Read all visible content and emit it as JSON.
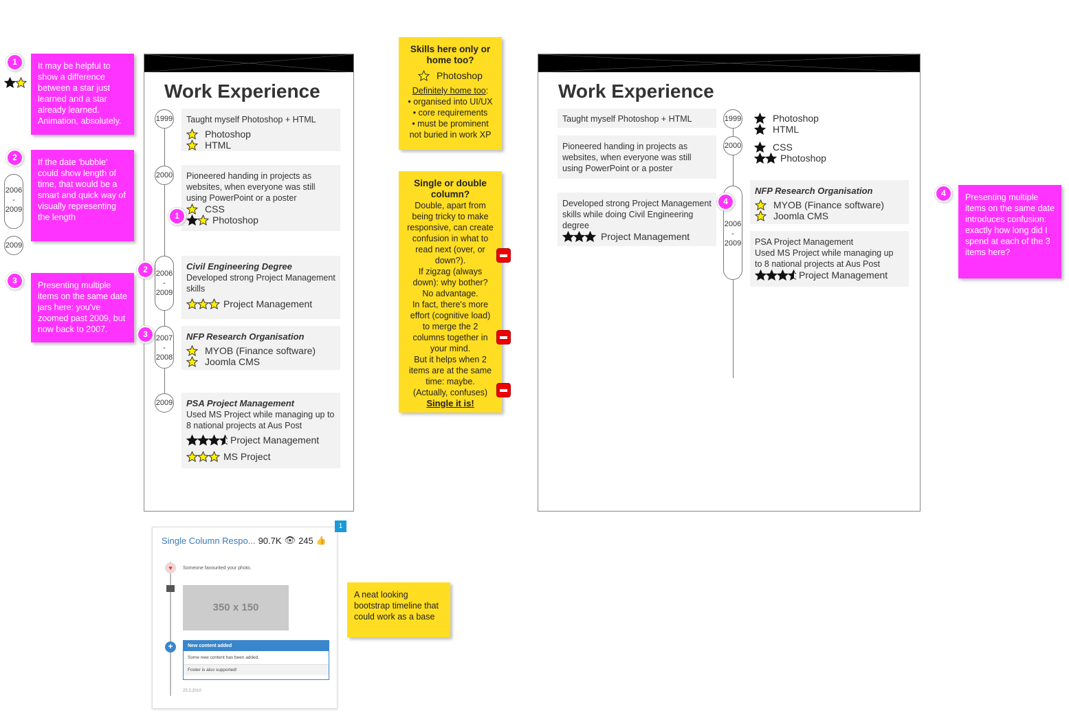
{
  "colors": {
    "pink": "#ff33ff",
    "yellow": "#ffdd22",
    "star_fill": "#ffee00",
    "star_dark": "#111111",
    "entry_bg": "#f2f2f2"
  },
  "left_notes": {
    "n1": {
      "num": "1",
      "text": "It may be helpful to show a difference between a star just learned and a star already learned. Animation, absolutely."
    },
    "n2": {
      "num": "2",
      "text": "If the date 'bubble' could show length of time, that would be a smart and quick way of visually representing the length",
      "pill_top": "2006",
      "pill_mid": "-",
      "pill_bot": "2009",
      "round": "2009"
    },
    "n3": {
      "num": "3",
      "text": "Presenting multiple items on the same date jars here: you've zoomed past 2009, but now back to 2007."
    },
    "n4": {
      "num": "4",
      "text": "Presenting multiple items on the same date introduces confusion: exactly how long did I spend at each of the 3 items here?"
    }
  },
  "yellow_notes": {
    "skills": {
      "title": "Skills here only or home too?",
      "skill": "Photoshop",
      "link": "Definitely home too",
      "colon": ":",
      "lines": [
        "• organised into UI/UX",
        "• core requirements",
        "• must be prominent",
        "not buried in work XP"
      ]
    },
    "column": {
      "title": "Single or double column?",
      "lines": [
        "Double, apart from",
        "being tricky to make",
        "responsive, can create",
        "confusion in what to",
        "read next (over, or",
        "down?).",
        "If zigzag (always",
        "down): why bother?",
        "No advantage.",
        "In fact, there's more",
        "effort (cognitive load)",
        "to merge the 2",
        "columns together in",
        "your mind.",
        "But it helps when 2",
        "items are at the same",
        "time: maybe.",
        "(Actually, confuses)"
      ],
      "conclusion": "Single it is!"
    },
    "bootstrap": {
      "text": "A neat looking bootstrap timeline that could work as a base"
    }
  },
  "single_column": {
    "title": "Work Experience",
    "entries": [
      {
        "date": "1999",
        "desc": "Taught myself Photoshop + HTML",
        "skills": [
          {
            "name": "Photoshop",
            "stars": "y"
          },
          {
            "name": "HTML",
            "stars": "y"
          }
        ]
      },
      {
        "date": "2000",
        "desc": "Pioneered handing in projects as websites, when everyone was still using PowerPoint or a poster",
        "skills": [
          {
            "name": "CSS",
            "stars": "y"
          },
          {
            "name": "Photoshop",
            "stars": "dy"
          }
        ]
      },
      {
        "date_top": "2006",
        "date_mid": "-",
        "date_bot": "2009",
        "org": "Civil Engineering Degree",
        "desc": "Developed strong Project Management skills",
        "skills": [
          {
            "name": "Project Management",
            "stars": "yyy"
          }
        ]
      },
      {
        "date_top": "2007",
        "date_mid": "-",
        "date_bot": "2008",
        "org": "NFP Research Organisation",
        "skills": [
          {
            "name": "MYOB (Finance software)",
            "stars": "y"
          },
          {
            "name": "Joomla CMS",
            "stars": "y"
          }
        ]
      },
      {
        "date": "2009",
        "org": "PSA Project Management",
        "desc": "Used MS Project while managing up to 8 national projects at Aus Post",
        "skills": [
          {
            "name": "Project Management",
            "stars": "dddh"
          },
          {
            "name": "MS Project",
            "stars": "yyy"
          }
        ]
      }
    ]
  },
  "double_column": {
    "title": "Work Experience",
    "left": [
      {
        "desc": "Taught myself Photoshop + HTML"
      },
      {
        "desc": "Pioneered handing in projects as websites, when everyone was still using PowerPoint or a poster"
      },
      {
        "desc": "Developed strong Project Management skills while doing Civil Engineering degree",
        "skill": "Project Management"
      }
    ],
    "dates": {
      "d1": "1999",
      "d2": "2000",
      "pill_top": "2006",
      "pill_mid": "-",
      "pill_bot": "2009"
    },
    "right_skills_1999": [
      "Photoshop",
      "HTML"
    ],
    "right_skills_2000": [
      "CSS",
      "Photoshop"
    ],
    "nfp": {
      "org": "NFP Research Organisation",
      "skills": [
        "MYOB (Finance software)",
        "Joomla CMS"
      ]
    },
    "psa": {
      "lines": [
        "PSA Project Management",
        "Used MS Project while managing up",
        "to 8 national projects at Aus Post"
      ],
      "skill": "Project Management"
    }
  },
  "screenshot_card": {
    "title": "Single Column Respo...",
    "views": "90.7K",
    "likes": "245",
    "badge": "1",
    "inner_text1": "Someone favourited your photo.",
    "placeholder": "350 x 150",
    "panel_title": "New content added",
    "panel_body": "Some new content has been added.",
    "panel_footer": "Footer is also supported!",
    "date_caption": "25.3.2010"
  }
}
